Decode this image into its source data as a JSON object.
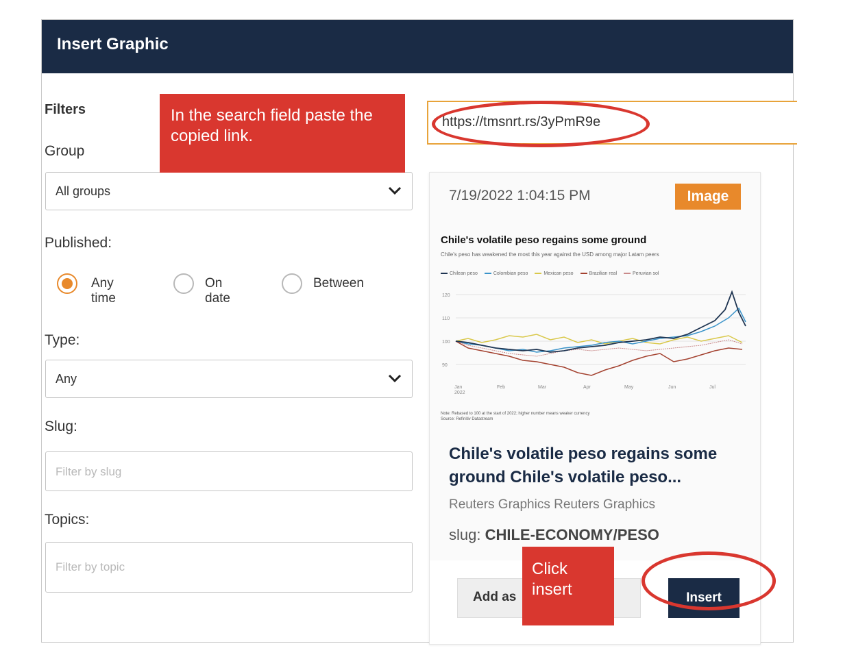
{
  "dialog": {
    "title": "Insert Graphic"
  },
  "filters": {
    "heading": "Filters",
    "group_label": "Group",
    "group_value": "All groups",
    "published_label": "Published:",
    "published_options": [
      "Any time",
      "On date",
      "Between"
    ],
    "published_selected": "Any time",
    "type_label": "Type:",
    "type_value": "Any",
    "slug_label": "Slug:",
    "slug_placeholder": "Filter by slug",
    "topics_label": "Topics:",
    "topics_placeholder": "Filter by topic"
  },
  "search": {
    "value": "https://tmsnrt.rs/3yPmR9e"
  },
  "result": {
    "date": "7/19/2022 1:04:15 PM",
    "badge": "Image",
    "headline": "Chile's volatile peso regains some ground Chile's volatile peso...",
    "byline": "Reuters Graphics Reuters Graphics",
    "slug_prefix": "slug:",
    "slug_value": "CHILE-ECONOMY/PESO",
    "attach_button": "Add as attachment",
    "insert_button": "Insert",
    "thumbnail": {
      "title": "Chile's volatile peso regains some ground",
      "subtitle": "Chile's peso has weakened the most this year against the USD among major Latam peers",
      "legend": [
        {
          "name": "Chilean peso",
          "color": "#1f3552"
        },
        {
          "name": "Colombian peso",
          "color": "#3a93c9"
        },
        {
          "name": "Mexican peso",
          "color": "#d9c84a"
        },
        {
          "name": "Brazilian real",
          "color": "#a3412f"
        },
        {
          "name": "Peruvian sol",
          "color": "#c98a8a"
        }
      ],
      "y_ticks": [
        "120",
        "110",
        "100",
        "90"
      ],
      "x_ticks": [
        "Jan\n2022",
        "Feb",
        "Mar",
        "Apr",
        "May",
        "Jun",
        "Jul"
      ],
      "note": "Note: Rebased to 100 at the start of 2022; higher number means weaker currency",
      "source": "Source: Refinitiv Datastream"
    }
  },
  "annotations": {
    "callout_search": "In the search field paste the copied link.",
    "callout_insert": "Click insert",
    "accent_color": "#d9372f"
  },
  "colors": {
    "header": "#1a2b45",
    "orange": "#e8892b"
  }
}
